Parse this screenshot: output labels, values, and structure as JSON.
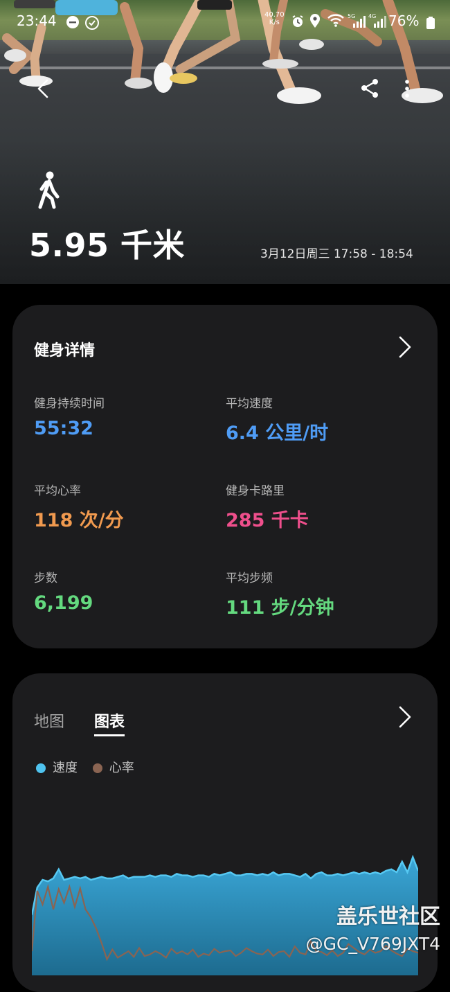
{
  "status_bar": {
    "time": "23:44",
    "net_speed_value": "40.70",
    "net_speed_unit": "K/s",
    "battery": "76%",
    "icons": [
      "minus-circle-icon",
      "whatsapp-icon",
      "alarm-icon",
      "location-icon",
      "wifi-icon",
      "signal-5g-icon",
      "signal-4g-icon",
      "battery-icon"
    ]
  },
  "header": {
    "icons": [
      "back-icon",
      "share-icon",
      "more-icon"
    ],
    "activity_icon": "walking-icon",
    "distance": "5.95 千米",
    "date_range": "3月12日周三 17:58 - 18:54"
  },
  "details": {
    "title": "健身详情",
    "stats": [
      {
        "label": "健身持续时间",
        "value": "55:32",
        "color": "#4f9cf5"
      },
      {
        "label": "平均速度",
        "value": "6.4 公里/时",
        "color": "#4f9cf5"
      },
      {
        "label": "平均心率",
        "value": "118 次/分",
        "color": "#f19a4f"
      },
      {
        "label": "健身卡路里",
        "value": "285 千卡",
        "color": "#ef4f8c"
      },
      {
        "label": "步数",
        "value": "6,199",
        "color": "#64d97f"
      },
      {
        "label": "平均步频",
        "value": "111 步/分钟",
        "color": "#64d97f"
      }
    ]
  },
  "chart_card": {
    "tabs": [
      {
        "label": "地图",
        "active": false
      },
      {
        "label": "图表",
        "active": true
      }
    ],
    "legend": [
      {
        "label": "速度",
        "color": "#3ab0e0"
      },
      {
        "label": "心率",
        "color": "#8a6452"
      }
    ]
  },
  "chart_data": {
    "type": "area",
    "series": [
      {
        "name": "速度",
        "color": "#3ab0e0",
        "values": [
          4.0,
          5.8,
          6.3,
          6.2,
          6.4,
          7.0,
          6.3,
          6.4,
          6.5,
          6.4,
          6.5,
          6.3,
          6.4,
          6.5,
          6.4,
          6.4,
          6.5,
          6.6,
          6.4,
          6.5,
          6.5,
          6.5,
          6.6,
          6.5,
          6.6,
          6.6,
          6.5,
          6.7,
          6.6,
          6.6,
          6.5,
          6.6,
          6.6,
          6.5,
          6.7,
          6.6,
          6.7,
          6.8,
          6.6,
          6.6,
          6.7,
          6.7,
          6.6,
          6.7,
          6.6,
          6.8,
          6.6,
          6.7,
          6.7,
          6.6,
          6.5,
          6.7,
          6.4,
          6.7,
          6.8,
          6.6,
          6.6,
          6.7,
          6.6,
          6.7,
          6.8,
          6.7,
          6.8,
          6.7,
          6.8,
          6.7,
          6.9,
          7.0,
          6.8,
          7.5,
          6.8,
          7.8,
          6.9
        ]
      },
      {
        "name": "心率",
        "color": "#8a6452",
        "values": [
          70,
          145,
          128,
          150,
          122,
          147,
          130,
          150,
          125,
          148,
          122,
          112,
          98,
          80,
          60,
          72,
          62,
          66,
          70,
          63,
          74,
          64,
          66,
          70,
          67,
          62,
          73,
          67,
          70,
          66,
          72,
          63,
          67,
          65,
          73,
          68,
          70,
          71,
          64,
          68,
          74,
          70,
          67,
          66,
          72,
          64,
          69,
          70,
          63,
          76,
          68,
          66,
          82,
          70,
          69,
          65,
          71,
          64,
          68,
          79,
          74,
          69,
          66,
          72,
          68,
          70,
          77,
          71,
          67,
          64,
          73,
          70,
          68
        ]
      }
    ]
  },
  "watermark": {
    "title": "盖乐世社区",
    "user": "@GC_V769JXT4"
  }
}
